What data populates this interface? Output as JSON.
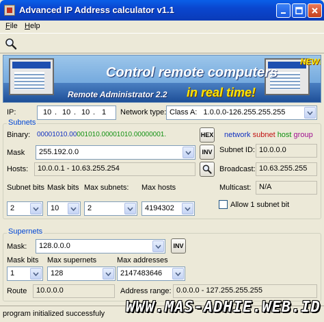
{
  "window": {
    "title": "Advanced IP Address calculator v1.1",
    "minimize_icon": "minimize-icon",
    "maximize_icon": "maximize-icon",
    "close_icon": "close-icon"
  },
  "menu": {
    "file": "File",
    "help": "Help"
  },
  "toolbar": {
    "search_icon": "search-icon"
  },
  "banner": {
    "headline": "Control remote computers",
    "product": "Remote Administrator 2.2",
    "tagline": "in real time!",
    "badge": "NEW!"
  },
  "ip": {
    "label": "IP:",
    "octets": [
      "10",
      "10",
      "10",
      "1"
    ],
    "network_type_label": "Network type:",
    "network_type_value": "Class A:   1.0.0.0-126.255.255.255"
  },
  "subnets": {
    "title": "Subnets",
    "binary_label": "Binary:",
    "binary_parts": [
      {
        "text": "00001010.00",
        "color": "#1030c0"
      },
      {
        "text": "001010.00001010.00000001.",
        "color": "#109010"
      }
    ],
    "hex_button": "HEX",
    "legend": [
      {
        "text": "network",
        "color": "#1030c0"
      },
      {
        "text": "subnet",
        "color": "#c01010"
      },
      {
        "text": "host",
        "color": "#109010"
      },
      {
        "text": "group",
        "color": "#a01090"
      }
    ],
    "mask_label": "Mask",
    "mask_value": "255.192.0.0",
    "inv_button": "INV",
    "subnet_id_label": "Subnet ID:",
    "subnet_id_value": "10.0.0.0",
    "hosts_label": "Hosts:",
    "hosts_value": "10.0.0.1 - 10.63.255.254",
    "broadcast_label": "Broadcast:",
    "broadcast_value": "10.63.255.255",
    "subnet_bits_label": "Subnet bits",
    "mask_bits_label": "Mask bits",
    "max_subnets_label": "Max subnets:",
    "max_hosts_label": "Max hosts",
    "multicast_label": "Multicast:",
    "multicast_value": "N/A",
    "subnet_bits_value": "2",
    "mask_bits_value": "10",
    "max_subnets_value": "2",
    "max_hosts_value": "4194302",
    "allow_subnet_label": "Allow 1 subnet bit",
    "allow_subnet_checked": false
  },
  "supernets": {
    "title": "Supernets",
    "mask_label": "Mask:",
    "mask_value": "128.0.0.0",
    "inv_button": "INV",
    "mask_bits_label": "Mask bits",
    "max_supernets_label": "Max supernets",
    "max_addresses_label": "Max addresses",
    "mask_bits_value": "1",
    "max_supernets_value": "128",
    "max_addresses_value": "2147483646",
    "route_label": "Route",
    "route_value": "10.0.0.0",
    "address_range_label": "Address range:",
    "address_range_value": "0.0.0.0 - 127.255.255.255"
  },
  "status": {
    "text": "program initialized successfuly"
  },
  "watermark": "WWW.MAS-ADHIE.WEB.ID"
}
